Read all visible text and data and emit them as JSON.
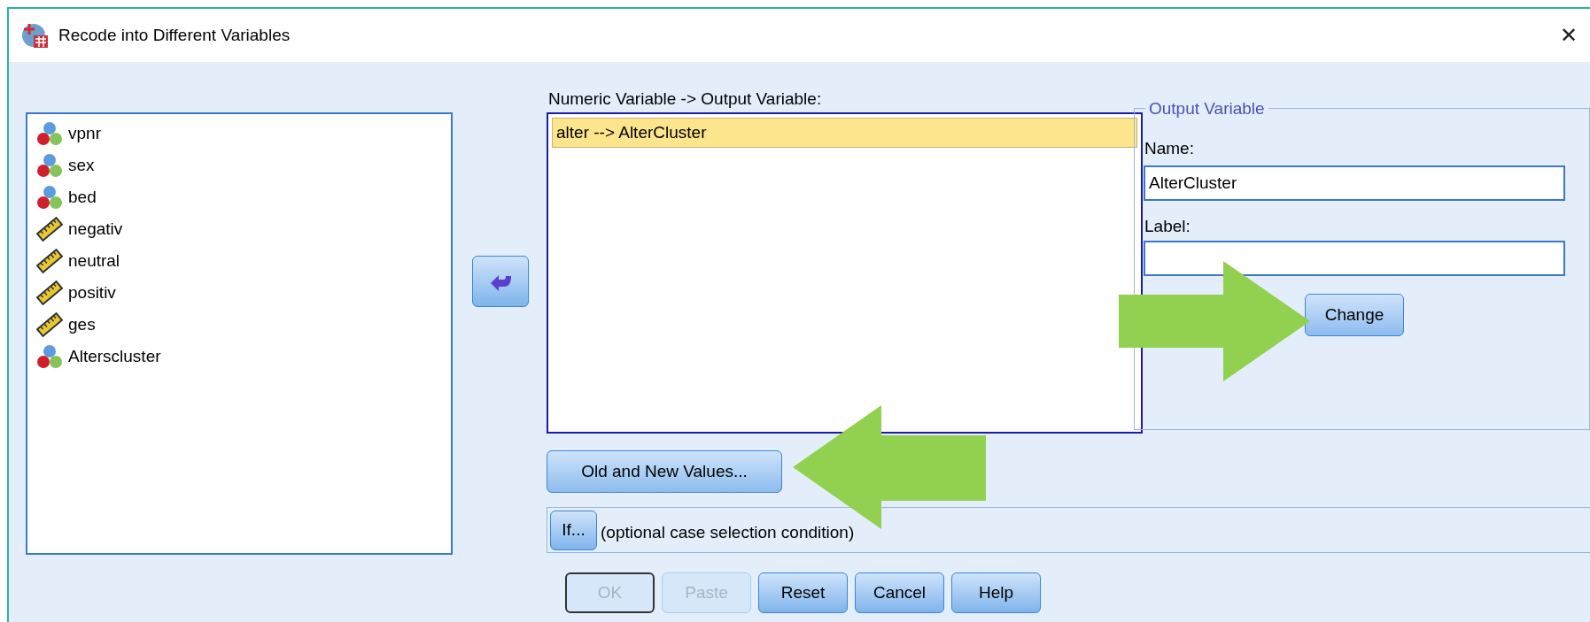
{
  "window": {
    "title": "Recode into Different Variables",
    "close": "✕"
  },
  "variables": [
    {
      "name": "vpnr",
      "kind": "nominal"
    },
    {
      "name": "sex",
      "kind": "nominal"
    },
    {
      "name": "bed",
      "kind": "nominal"
    },
    {
      "name": "negativ",
      "kind": "scale"
    },
    {
      "name": "neutral",
      "kind": "scale"
    },
    {
      "name": "positiv",
      "kind": "scale"
    },
    {
      "name": "ges",
      "kind": "scale"
    },
    {
      "name": "Alterscluster",
      "kind": "nominal"
    }
  ],
  "mapping": {
    "label": "Numeric Variable -> Output Variable:",
    "rows": [
      {
        "text": "alter --> AlterCluster",
        "selected": true
      }
    ]
  },
  "output_variable": {
    "title": "Output Variable",
    "name_label": "Name:",
    "name_value": "AlterCluster",
    "label_label": "Label:",
    "change_button": "Change"
  },
  "old_new_button": "Old and New Values...",
  "if_row": {
    "button": "If...",
    "text": "(optional case selection condition)"
  },
  "buttons": [
    {
      "label": "OK",
      "disabled": true,
      "default": true
    },
    {
      "label": "Paste",
      "disabled": true,
      "default": false
    },
    {
      "label": "Reset",
      "disabled": false,
      "default": false
    },
    {
      "label": "Cancel",
      "disabled": false,
      "default": false
    },
    {
      "label": "Help",
      "disabled": false,
      "default": false
    }
  ]
}
